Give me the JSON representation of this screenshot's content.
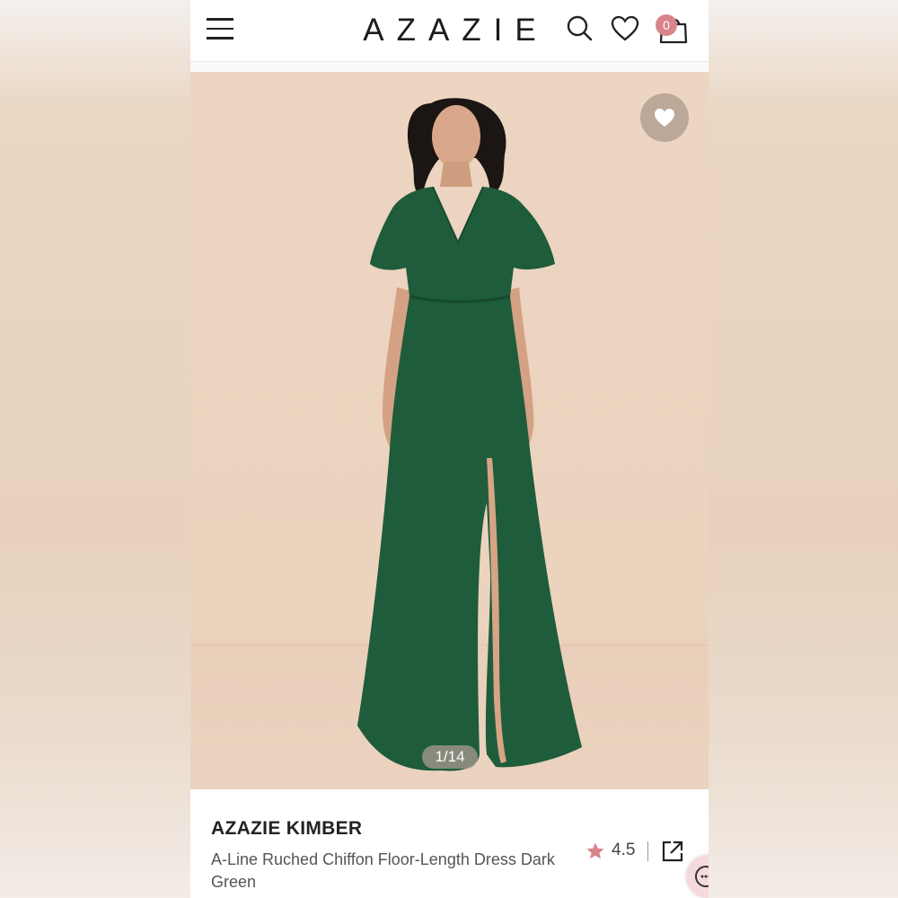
{
  "header": {
    "logo_text": "AZAZIE",
    "cart_count": "0"
  },
  "gallery": {
    "counter": "1/14"
  },
  "product": {
    "brand": "AZAZIE KIMBER",
    "title": "A-Line Ruched Chiffon Floor-Length Dress Dark Green",
    "rating": "4.5"
  },
  "colors": {
    "accent": "#d9838b",
    "dress": "#1f5c3b",
    "backdrop": "#ebd3be"
  },
  "icons": [
    "menu-icon",
    "search-icon",
    "heart-icon",
    "shopping-bag-icon",
    "favorite-heart-icon",
    "star-icon",
    "share-icon",
    "chat-icon"
  ]
}
